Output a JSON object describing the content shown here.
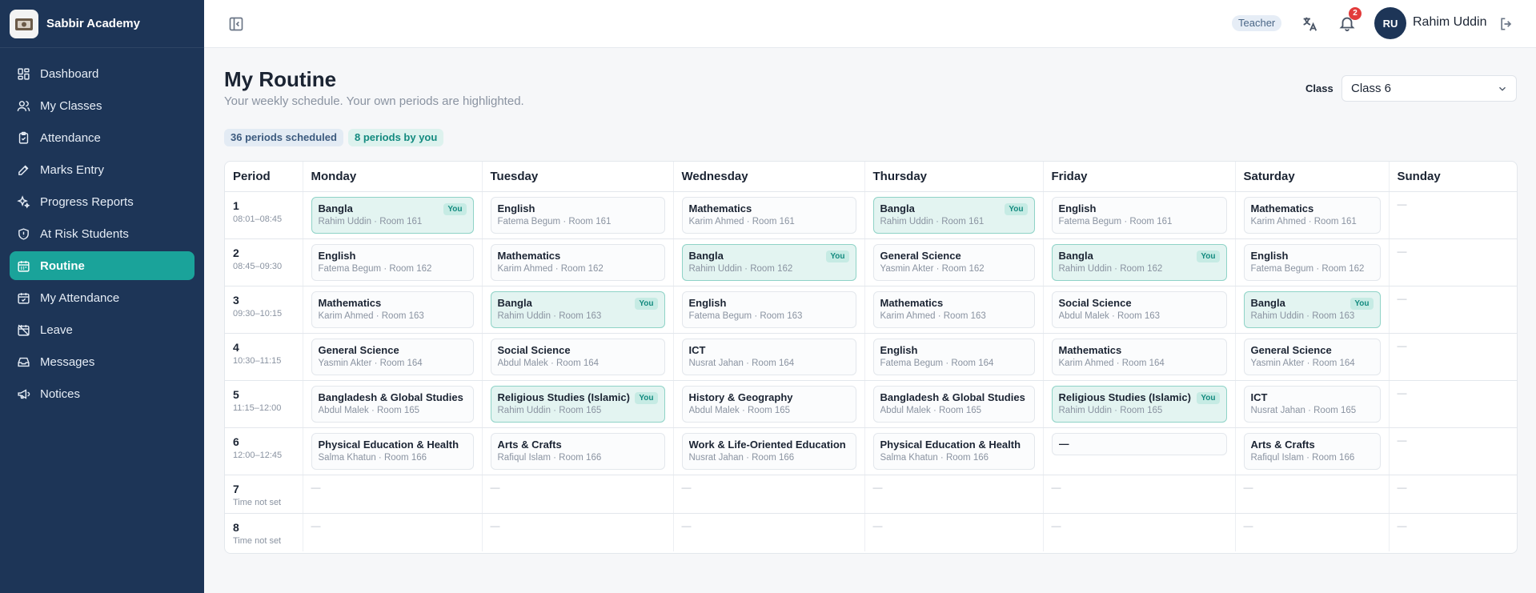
{
  "brand": {
    "name": "Sabbir Academy"
  },
  "sidebar": {
    "items": [
      {
        "label": "Dashboard",
        "icon": "dashboard-icon"
      },
      {
        "label": "My Classes",
        "icon": "users-icon"
      },
      {
        "label": "Attendance",
        "icon": "clipboard-check-icon"
      },
      {
        "label": "Marks Entry",
        "icon": "edit-icon"
      },
      {
        "label": "Progress Reports",
        "icon": "sparkles-icon"
      },
      {
        "label": "At Risk Students",
        "icon": "shield-alert-icon"
      },
      {
        "label": "Routine",
        "icon": "calendar-icon",
        "active": true
      },
      {
        "label": "My Attendance",
        "icon": "calendar-check-icon"
      },
      {
        "label": "Leave",
        "icon": "calendar-off-icon"
      },
      {
        "label": "Messages",
        "icon": "inbox-icon"
      },
      {
        "label": "Notices",
        "icon": "megaphone-icon"
      }
    ]
  },
  "topbar": {
    "role": "Teacher",
    "notification_count": "2",
    "avatar_initials": "RU",
    "user_name": "Rahim Uddin"
  },
  "page": {
    "title": "My Routine",
    "subtitle": "Your weekly schedule. Your own periods are highlighted.",
    "class_label": "Class",
    "class_selected": "Class 6",
    "stat_scheduled": "36 periods scheduled",
    "stat_mine": "8 periods by you"
  },
  "routine": {
    "headers": [
      "Period",
      "Monday",
      "Tuesday",
      "Wednesday",
      "Thursday",
      "Friday",
      "Saturday",
      "Sunday"
    ],
    "you_label": "You",
    "empty_mark": "—",
    "periods": [
      {
        "num": "1",
        "time": "08:01–08:45",
        "cells": [
          {
            "subject": "Bangla",
            "meta": "Rahim Uddin · Room 161",
            "mine": true
          },
          {
            "subject": "English",
            "meta": "Fatema Begum · Room 161"
          },
          {
            "subject": "Mathematics",
            "meta": "Karim Ahmed · Room 161"
          },
          {
            "subject": "Bangla",
            "meta": "Rahim Uddin · Room 161",
            "mine": true
          },
          {
            "subject": "English",
            "meta": "Fatema Begum · Room 161"
          },
          {
            "subject": "Mathematics",
            "meta": "Karim Ahmed · Room 161"
          },
          null
        ]
      },
      {
        "num": "2",
        "time": "08:45–09:30",
        "cells": [
          {
            "subject": "English",
            "meta": "Fatema Begum · Room 162"
          },
          {
            "subject": "Mathematics",
            "meta": "Karim Ahmed · Room 162"
          },
          {
            "subject": "Bangla",
            "meta": "Rahim Uddin · Room 162",
            "mine": true
          },
          {
            "subject": "General Science",
            "meta": "Yasmin Akter · Room 162"
          },
          {
            "subject": "Bangla",
            "meta": "Rahim Uddin · Room 162",
            "mine": true
          },
          {
            "subject": "English",
            "meta": "Fatema Begum · Room 162"
          },
          null
        ]
      },
      {
        "num": "3",
        "time": "09:30–10:15",
        "cells": [
          {
            "subject": "Mathematics",
            "meta": "Karim Ahmed · Room 163"
          },
          {
            "subject": "Bangla",
            "meta": "Rahim Uddin · Room 163",
            "mine": true
          },
          {
            "subject": "English",
            "meta": "Fatema Begum · Room 163"
          },
          {
            "subject": "Mathematics",
            "meta": "Karim Ahmed · Room 163"
          },
          {
            "subject": "Social Science",
            "meta": "Abdul Malek · Room 163"
          },
          {
            "subject": "Bangla",
            "meta": "Rahim Uddin · Room 163",
            "mine": true
          },
          null
        ]
      },
      {
        "num": "4",
        "time": "10:30–11:15",
        "cells": [
          {
            "subject": "General Science",
            "meta": "Yasmin Akter · Room 164"
          },
          {
            "subject": "Social Science",
            "meta": "Abdul Malek · Room 164"
          },
          {
            "subject": "ICT",
            "meta": "Nusrat Jahan · Room 164"
          },
          {
            "subject": "English",
            "meta": "Fatema Begum · Room 164"
          },
          {
            "subject": "Mathematics",
            "meta": "Karim Ahmed · Room 164"
          },
          {
            "subject": "General Science",
            "meta": "Yasmin Akter · Room 164"
          },
          null
        ]
      },
      {
        "num": "5",
        "time": "11:15–12:00",
        "cells": [
          {
            "subject": "Bangladesh & Global Studies",
            "meta": "Abdul Malek · Room 165"
          },
          {
            "subject": "Religious Studies (Islamic)",
            "meta": "Rahim Uddin · Room 165",
            "mine": true
          },
          {
            "subject": "History & Geography",
            "meta": "Abdul Malek · Room 165"
          },
          {
            "subject": "Bangladesh & Global Studies",
            "meta": "Abdul Malek · Room 165"
          },
          {
            "subject": "Religious Studies (Islamic)",
            "meta": "Rahim Uddin · Room 165",
            "mine": true
          },
          {
            "subject": "ICT",
            "meta": "Nusrat Jahan · Room 165"
          },
          null
        ]
      },
      {
        "num": "6",
        "time": "12:00–12:45",
        "cells": [
          {
            "subject": "Physical Education & Health",
            "meta": "Salma Khatun · Room 166"
          },
          {
            "subject": "Arts & Crafts",
            "meta": "Rafiqul Islam · Room 166"
          },
          {
            "subject": "Work & Life-Oriented Education",
            "meta": "Nusrat Jahan · Room 166"
          },
          {
            "subject": "Physical Education & Health",
            "meta": "Salma Khatun · Room 166"
          },
          {
            "subject": "—",
            "meta": "",
            "boxed_empty": true
          },
          {
            "subject": "Arts & Crafts",
            "meta": "Rafiqul Islam · Room 166"
          },
          null
        ]
      },
      {
        "num": "7",
        "time": "Time not set",
        "cells": [
          null,
          null,
          null,
          null,
          null,
          null,
          null
        ]
      },
      {
        "num": "8",
        "time": "Time not set",
        "cells": [
          null,
          null,
          null,
          null,
          null,
          null,
          null
        ]
      }
    ]
  },
  "colors": {
    "sidebar": "#1d3557",
    "accent": "#1aa39a",
    "mine_bg": "#e3f4f1",
    "badge_red": "#e23b3b"
  }
}
